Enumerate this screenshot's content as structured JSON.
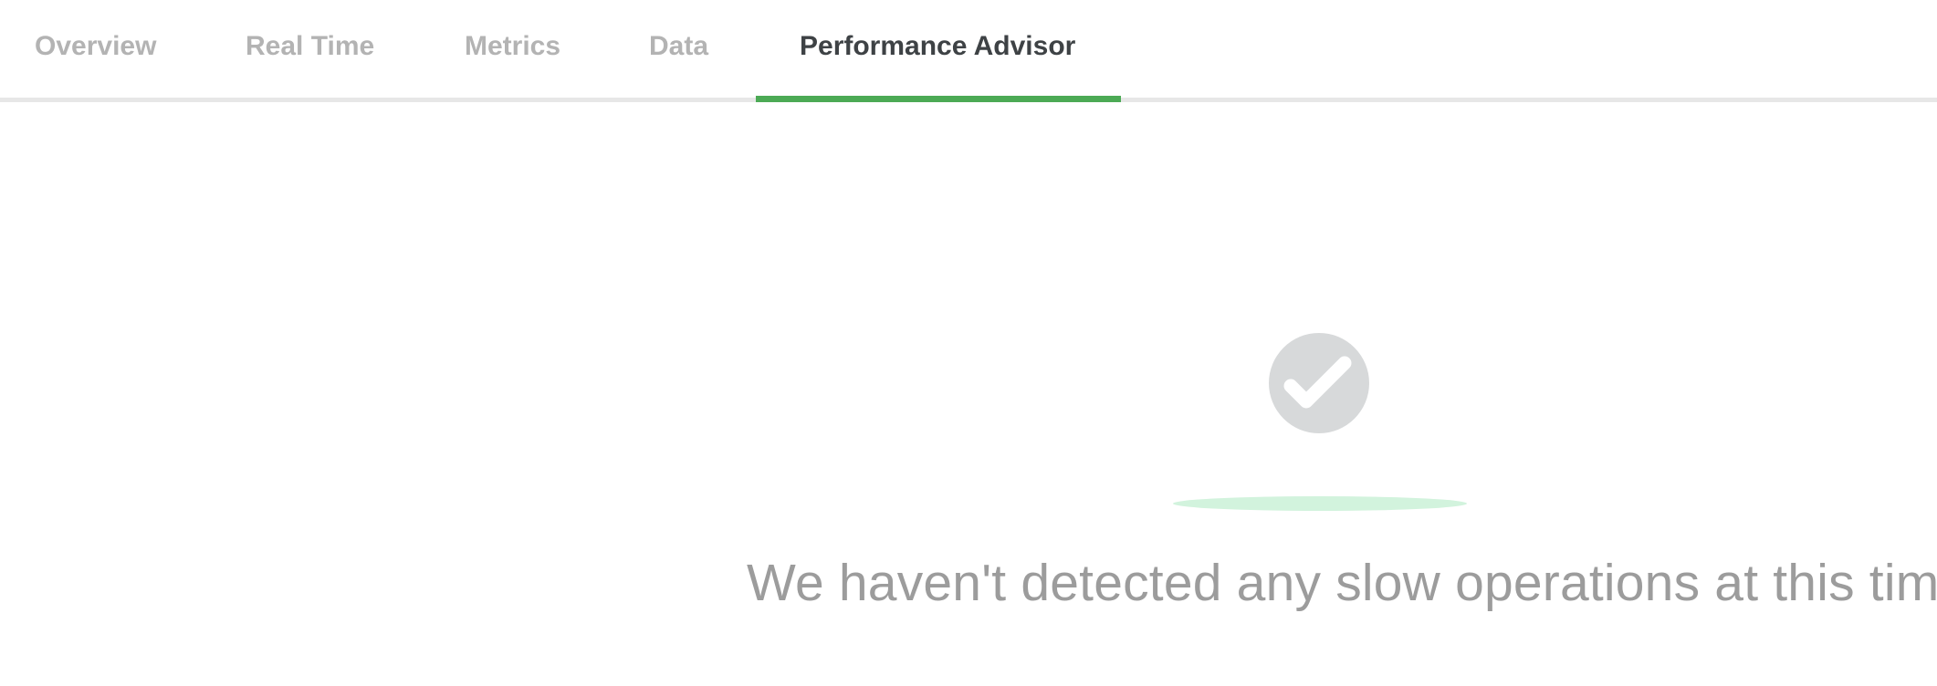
{
  "tabs": {
    "items": [
      {
        "label": "Overview",
        "active": false
      },
      {
        "label": "Real Time",
        "active": false
      },
      {
        "label": "Metrics",
        "active": false
      },
      {
        "label": "Data",
        "active": false
      },
      {
        "label": "Performance Advisor",
        "active": true
      }
    ]
  },
  "empty_state": {
    "icon": "checkmark-circle-icon",
    "message": "We haven't detected any slow operations at this time"
  },
  "colors": {
    "active_tab_text": "#3e4245",
    "inactive_tab_text": "#b3b3b3",
    "accent_underline": "#4caa55",
    "icon_circle": "#d7d9da",
    "shadow": "#d2f3dd",
    "message_text": "#9c9c9c"
  }
}
